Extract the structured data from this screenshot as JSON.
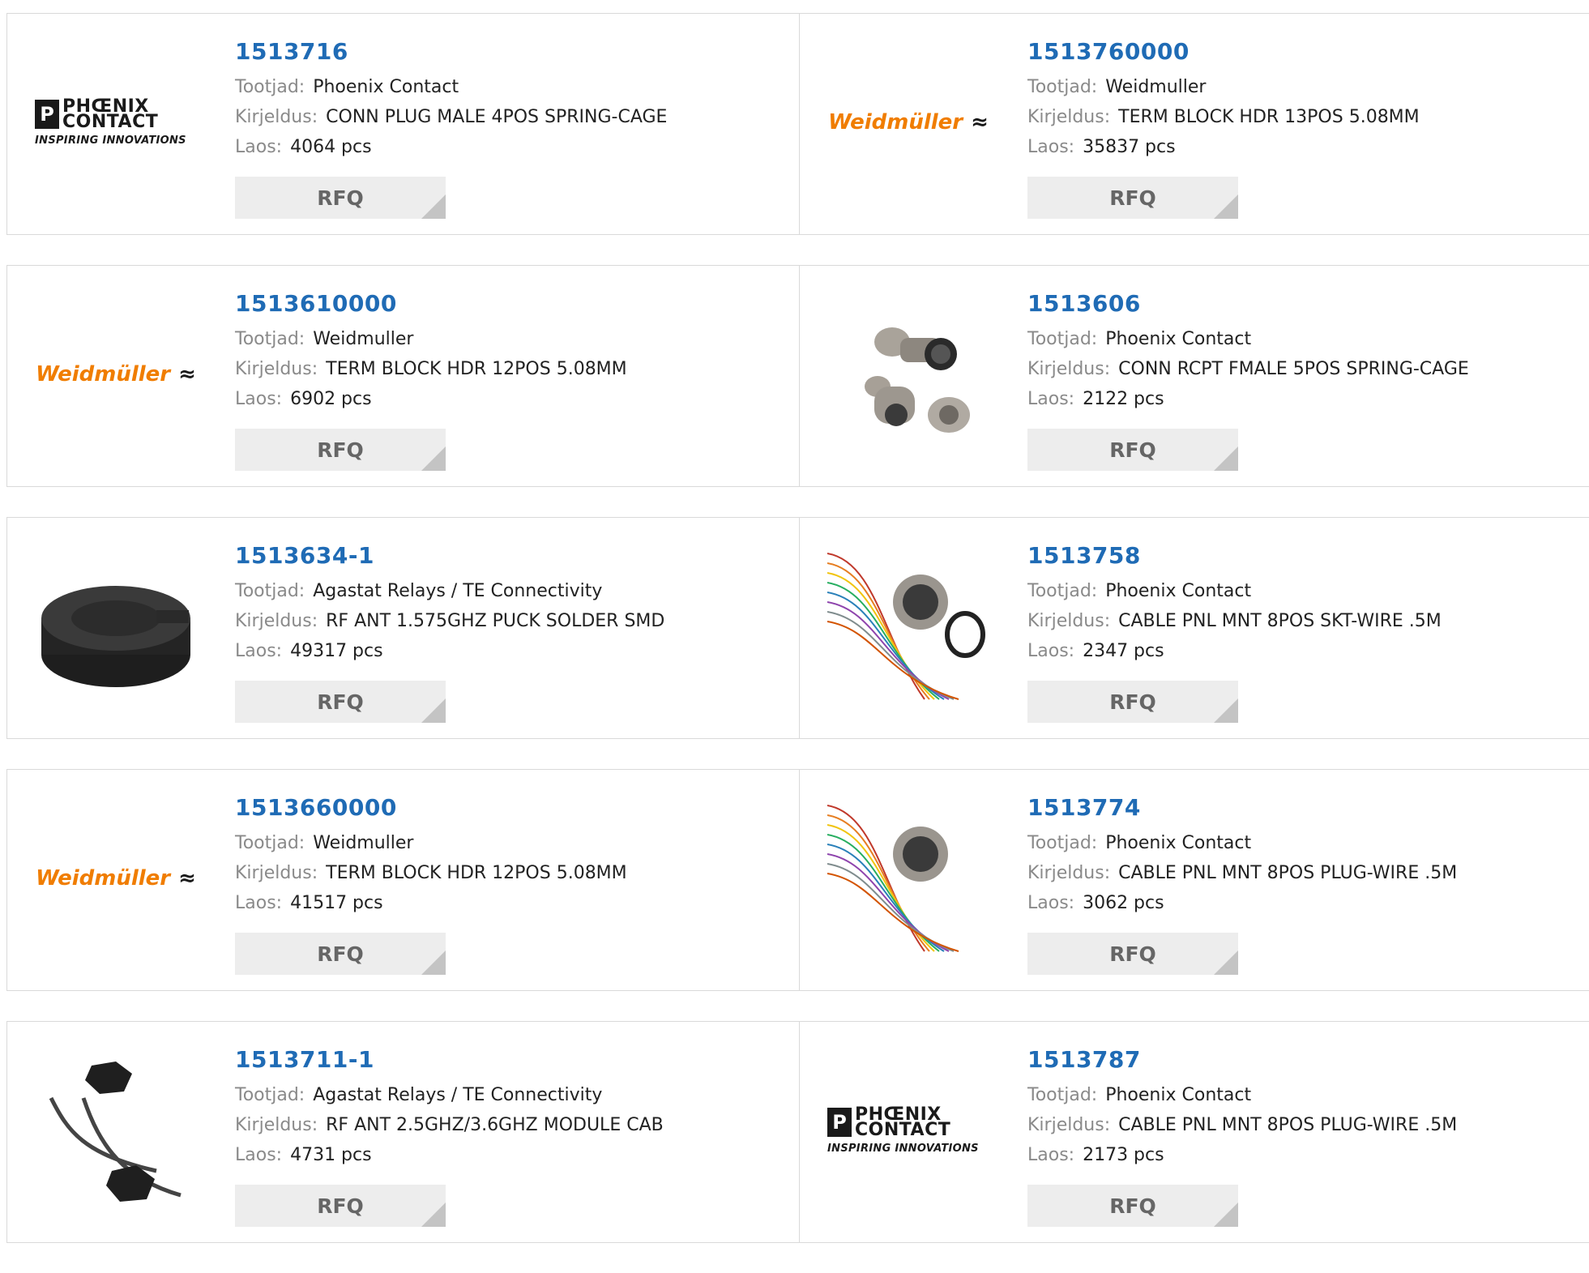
{
  "labels": {
    "manufacturer": "Tootjad:",
    "description": "Kirjeldus:",
    "stock": "Laos:",
    "rfq": "RFQ"
  },
  "logos": {
    "phoenix": {
      "line1": "PHŒNIX",
      "line2": "CONTACT",
      "tagline": "INSPIRING INNOVATIONS"
    },
    "weidmuller": {
      "name": "Weidmüller",
      "symbol": "≈"
    }
  },
  "colors": {
    "part_number": "#1f6bb5",
    "weidmuller_orange": "#f07d00",
    "rfq_bg": "#ededed"
  },
  "products": [
    {
      "part": "1513716",
      "manufacturer": "Phoenix Contact",
      "description": "CONN PLUG MALE 4POS SPRING-CAGE",
      "stock": "4064 pcs",
      "image": "phoenix-logo"
    },
    {
      "part": "1513760000",
      "manufacturer": "Weidmuller",
      "description": "TERM BLOCK HDR 13POS 5.08MM",
      "stock": "35837 pcs",
      "image": "weidmuller-logo"
    },
    {
      "part": "1513610000",
      "manufacturer": "Weidmuller",
      "description": "TERM BLOCK HDR 12POS 5.08MM",
      "stock": "6902 pcs",
      "image": "weidmuller-logo"
    },
    {
      "part": "1513606",
      "manufacturer": "Phoenix Contact",
      "description": "CONN RCPT FMALE 5POS SPRING-CAGE",
      "stock": "2122 pcs",
      "image": "connector-photo"
    },
    {
      "part": "1513634-1",
      "manufacturer": "Agastat Relays / TE Connectivity",
      "description": "RF ANT 1.575GHZ PUCK SOLDER SMD",
      "stock": "49317 pcs",
      "image": "puck-antenna-photo"
    },
    {
      "part": "1513758",
      "manufacturer": "Phoenix Contact",
      "description": "CABLE PNL MNT 8POS SKT-WIRE .5M",
      "stock": "2347 pcs",
      "image": "cable-socket-photo"
    },
    {
      "part": "1513660000",
      "manufacturer": "Weidmuller",
      "description": "TERM BLOCK HDR 12POS 5.08MM",
      "stock": "41517 pcs",
      "image": "weidmuller-logo"
    },
    {
      "part": "1513774",
      "manufacturer": "Phoenix Contact",
      "description": "CABLE PNL MNT 8POS PLUG-WIRE .5M",
      "stock": "3062 pcs",
      "image": "cable-plug-photo"
    },
    {
      "part": "1513711-1",
      "manufacturer": "Agastat Relays / TE Connectivity",
      "description": "RF ANT 2.5GHZ/3.6GHZ MODULE CAB",
      "stock": "4731 pcs",
      "image": "module-antenna-photo"
    },
    {
      "part": "1513787",
      "manufacturer": "Phoenix Contact",
      "description": "CABLE PNL MNT 8POS PLUG-WIRE .5M",
      "stock": "2173 pcs",
      "image": "phoenix-logo"
    }
  ]
}
